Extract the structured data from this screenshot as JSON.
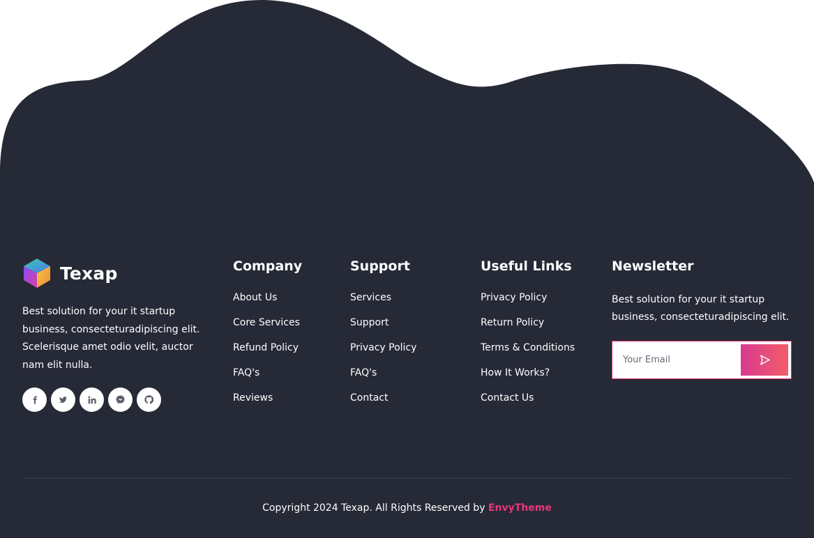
{
  "colors": {
    "background": "#262936",
    "accent": "#e5307a",
    "text": "#ffffff"
  },
  "brand": {
    "name": "Texap",
    "logo_icon": "hexagon-logo-icon",
    "description": "Best solution for your it startup business, consecteturadipiscing elit. Scelerisque amet odio velit, auctor nam elit nulla."
  },
  "socials": [
    {
      "icon": "facebook-icon"
    },
    {
      "icon": "twitter-icon"
    },
    {
      "icon": "linkedin-icon"
    },
    {
      "icon": "messenger-icon"
    },
    {
      "icon": "github-icon"
    }
  ],
  "columns": {
    "company": {
      "title": "Company",
      "links": [
        "About Us",
        "Core Services",
        "Refund Policy",
        "FAQ's",
        "Reviews"
      ]
    },
    "support": {
      "title": "Support",
      "links": [
        "Services",
        "Support",
        "Privacy Policy",
        "FAQ's",
        "Contact"
      ]
    },
    "useful": {
      "title": "Useful Links",
      "links": [
        "Privacy Policy",
        "Return Policy",
        "Terms & Conditions",
        "How It Works?",
        "Contact Us"
      ]
    }
  },
  "newsletter": {
    "title": "Newsletter",
    "text": "Best solution for your it startup business, consecteturadipiscing elit.",
    "placeholder": "Your Email",
    "send_icon": "send-icon"
  },
  "footer": {
    "copyright_text": "Copyright 2024 Texap. All Rights Reserved by",
    "author": "EnvyTheme"
  }
}
